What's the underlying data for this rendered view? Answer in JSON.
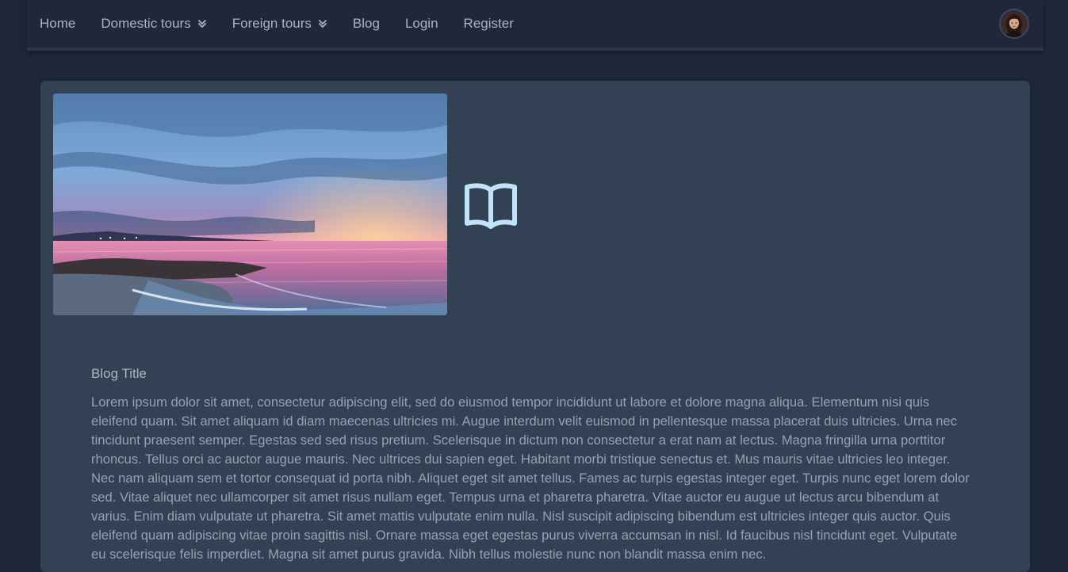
{
  "nav": {
    "items": [
      {
        "label": "Home"
      },
      {
        "label": "Domestic tours",
        "dropdown": true
      },
      {
        "label": "Foreign tours",
        "dropdown": true
      },
      {
        "label": "Blog"
      },
      {
        "label": "Login"
      },
      {
        "label": "Register"
      }
    ],
    "dropdown_icon": "double-chevron-down-icon",
    "avatar_icon": "user-avatar"
  },
  "blog": {
    "image": "sunset-beach-photo",
    "icon": "open-book-icon",
    "title": "Blog Title",
    "body": "Lorem ipsum dolor sit amet, consectetur adipiscing elit, sed do eiusmod tempor incididunt ut labore et dolore magna aliqua. Elementum nisi quis eleifend quam. Sit amet aliquam id diam maecenas ultricies mi. Augue interdum velit euismod in pellentesque massa placerat duis ultricies. Urna nec tincidunt praesent semper. Egestas sed sed risus pretium. Scelerisque in dictum non consectetur a erat nam at lectus. Magna fringilla urna porttitor rhoncus. Tellus orci ac auctor augue mauris. Nec ultrices dui sapien eget. Habitant morbi tristique senectus et. Mus mauris vitae ultricies leo integer. Nec nam aliquam sem et tortor consequat id porta nibh. Aliquet eget sit amet tellus. Fames ac turpis egestas integer eget. Turpis nunc eget lorem dolor sed. Vitae aliquet nec ullamcorper sit amet risus nullam eget. Tempus urna et pharetra pharetra. Vitae auctor eu augue ut lectus arcu bibendum at varius. Enim diam vulputate ut pharetra. Sit amet mattis vulputate enim nulla. Nisl suscipit adipiscing bibendum est ultricies integer quis auctor. Quis eleifend quam adipiscing vitae proin sagittis nisl. Ornare massa eget egestas purus viverra accumsan in nisl. Id faucibus nisl tincidunt eget. Vulputate eu scelerisque felis imperdiet. Magna sit amet purus gravida. Nibh tellus molestie nunc non blandit massa enim nec."
  },
  "colors": {
    "page_bg": "#1d2638",
    "nav_bg": "#1f283b",
    "card_bg": "#334155",
    "icon_accent": "#bfe3fb"
  }
}
